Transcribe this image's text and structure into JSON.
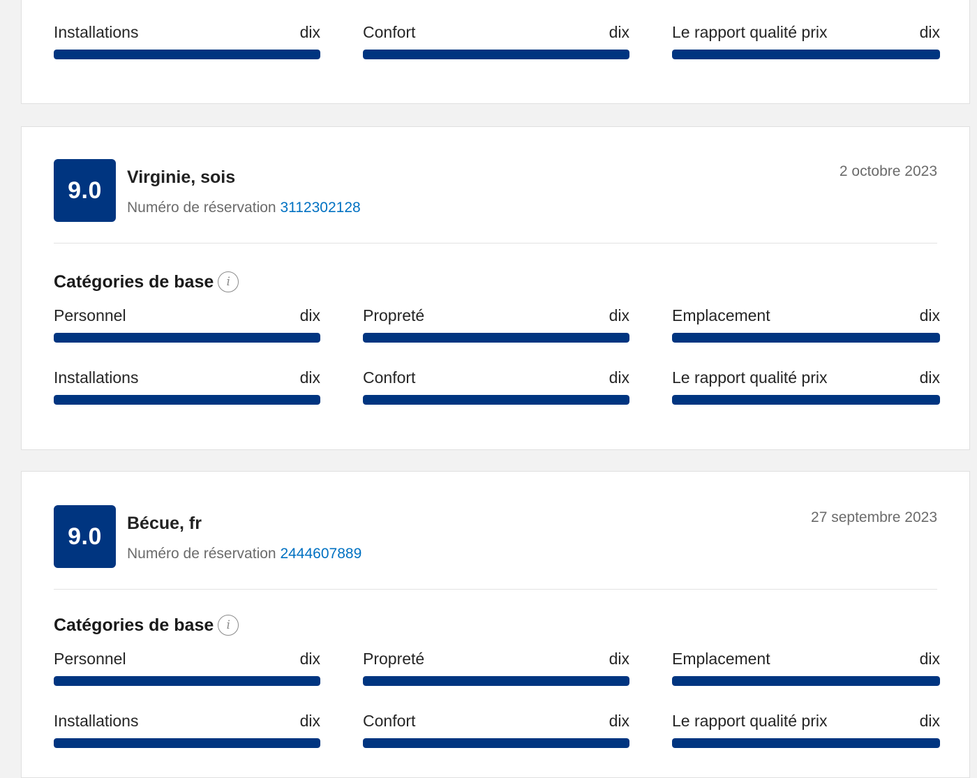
{
  "colors": {
    "score_bg": "#003580",
    "bar_fill": "#003580",
    "link": "#0071c2",
    "page_bg": "#f2f2f2"
  },
  "icons": {
    "info": "info-circle-icon"
  },
  "partial_card": {
    "metrics": [
      {
        "label": "Installations",
        "value": "dix",
        "fill": 1.0
      },
      {
        "label": "Confort",
        "value": "dix",
        "fill": 1.0
      },
      {
        "label": "Le rapport qualité prix",
        "value": "dix",
        "fill": 1.0
      }
    ]
  },
  "reviews": [
    {
      "score": "9.0",
      "reviewer": "Virginie, sois",
      "booking_label": "Numéro de réservation",
      "booking_number": "3112302128",
      "date": "2 octobre 2023",
      "categories_title": "Catégories de base",
      "info_glyph": "i",
      "metrics": [
        {
          "label": "Personnel",
          "value": "dix",
          "fill": 1.0
        },
        {
          "label": "Propreté",
          "value": "dix",
          "fill": 1.0
        },
        {
          "label": "Emplacement",
          "value": "dix",
          "fill": 1.0
        },
        {
          "label": "Installations",
          "value": "dix",
          "fill": 1.0
        },
        {
          "label": "Confort",
          "value": "dix",
          "fill": 1.0
        },
        {
          "label": "Le rapport qualité prix",
          "value": "dix",
          "fill": 1.0
        }
      ]
    },
    {
      "score": "9.0",
      "reviewer": "Bécue, fr",
      "booking_label": "Numéro de réservation",
      "booking_number": "2444607889",
      "date": "27 septembre 2023",
      "categories_title": "Catégories de base",
      "info_glyph": "i",
      "metrics": [
        {
          "label": "Personnel",
          "value": "dix",
          "fill": 1.0
        },
        {
          "label": "Propreté",
          "value": "dix",
          "fill": 1.0
        },
        {
          "label": "Emplacement",
          "value": "dix",
          "fill": 1.0
        },
        {
          "label": "Installations",
          "value": "dix",
          "fill": 1.0
        },
        {
          "label": "Confort",
          "value": "dix",
          "fill": 1.0
        },
        {
          "label": "Le rapport qualité prix",
          "value": "dix",
          "fill": 1.0
        }
      ]
    }
  ]
}
